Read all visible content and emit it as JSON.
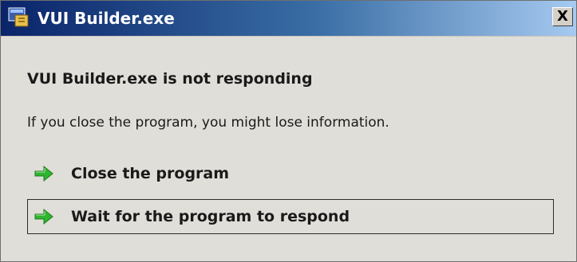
{
  "window": {
    "title": "VUI Builder.exe",
    "close_glyph": "X",
    "title_icon": "application-icon"
  },
  "dialog": {
    "heading": "VUI Builder.exe is not responding",
    "message": "If you close the program, you might lose information.",
    "options": [
      {
        "label": "Close the program",
        "icon": "green-arrow-icon",
        "focused": false
      },
      {
        "label": "Wait for the program to respond",
        "icon": "green-arrow-icon",
        "focused": true
      }
    ]
  },
  "colors": {
    "titlebar_start": "#0a246a",
    "titlebar_end": "#a6caf0",
    "background": "#e0ded8",
    "arrow": "#2fb52f"
  }
}
